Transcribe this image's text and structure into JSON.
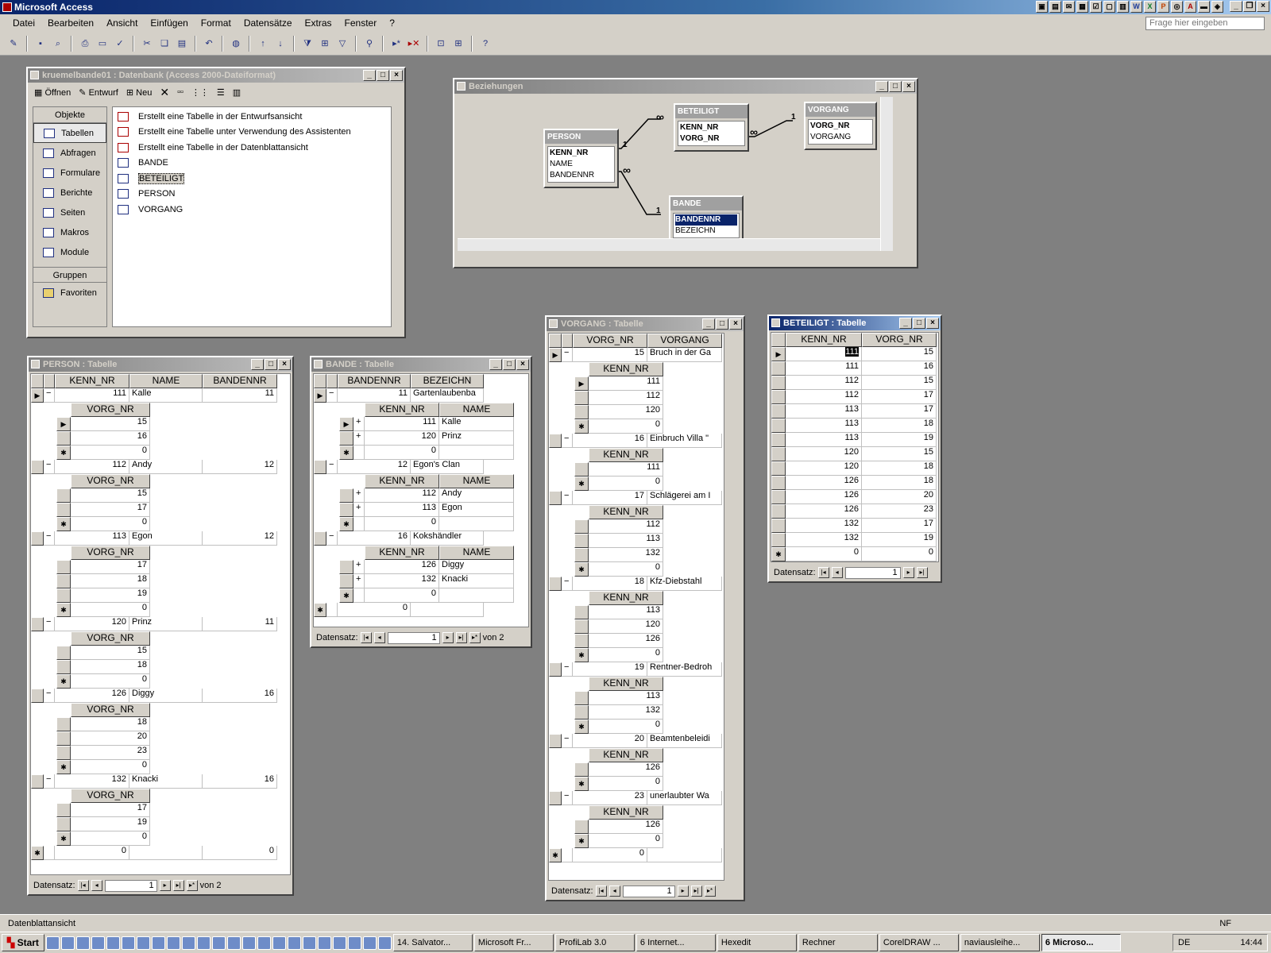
{
  "app_title": "Microsoft Access",
  "menu": [
    "Datei",
    "Bearbeiten",
    "Ansicht",
    "Einfügen",
    "Format",
    "Datensätze",
    "Extras",
    "Fenster",
    "?"
  ],
  "help_placeholder": "Frage hier eingeben",
  "db_window": {
    "title": "kruemelbande01 : Datenbank (Access 2000-Dateiformat)",
    "toolbar": {
      "open": "Öffnen",
      "design": "Entwurf",
      "new": "Neu"
    },
    "objects_header": "Objekte",
    "objects": [
      "Tabellen",
      "Abfragen",
      "Formulare",
      "Berichte",
      "Seiten",
      "Makros",
      "Module"
    ],
    "groups_header": "Gruppen",
    "favorites": "Favoriten",
    "list": [
      "Erstellt eine Tabelle in der Entwurfsansicht",
      "Erstellt eine Tabelle unter Verwendung des Assistenten",
      "Erstellt eine Tabelle in der Datenblattansicht",
      "BANDE",
      "BETEILIGT",
      "PERSON",
      "VORGANG"
    ]
  },
  "relations_window": {
    "title": "Beziehungen",
    "person": {
      "name": "PERSON",
      "fields": [
        "KENN_NR",
        "NAME",
        "BANDENNR"
      ]
    },
    "beteiligt": {
      "name": "BETEILIGT",
      "fields": [
        "KENN_NR",
        "VORG_NR"
      ]
    },
    "vorgang": {
      "name": "VORGANG",
      "fields": [
        "VORG_NR",
        "VORGANG"
      ]
    },
    "bande": {
      "name": "BANDE",
      "fields": [
        "BANDENNR",
        "BEZEICHN"
      ]
    },
    "one": "1",
    "many": "∞"
  },
  "person_table": {
    "title": "PERSON : Tabelle",
    "headers": [
      "KENN_NR",
      "NAME",
      "BANDENNR"
    ],
    "sub_header": "VORG_NR",
    "groups": [
      {
        "kenn": "111",
        "name": "Kalle",
        "bande": "11",
        "vorg": [
          "15",
          "16"
        ]
      },
      {
        "kenn": "112",
        "name": "Andy",
        "bande": "12",
        "vorg": [
          "15",
          "17"
        ]
      },
      {
        "kenn": "113",
        "name": "Egon",
        "bande": "12",
        "vorg": [
          "17",
          "18",
          "19"
        ]
      },
      {
        "kenn": "120",
        "name": "Prinz",
        "bande": "11",
        "vorg": [
          "15",
          "18"
        ]
      },
      {
        "kenn": "126",
        "name": "Diggy",
        "bande": "16",
        "vorg": [
          "18",
          "20",
          "23"
        ]
      },
      {
        "kenn": "132",
        "name": "Knacki",
        "bande": "16",
        "vorg": [
          "17",
          "19"
        ]
      }
    ],
    "new_row": [
      "0",
      "",
      "0"
    ],
    "nav_label": "Datensatz:",
    "nav_value": "1",
    "nav_of": "von  2"
  },
  "bande_table": {
    "title": "BANDE : Tabelle",
    "headers": [
      "BANDENNR",
      "BEZEICHN"
    ],
    "sub_headers": [
      "KENN_NR",
      "NAME"
    ],
    "groups": [
      {
        "nr": "11",
        "bez": "Gartenlaubenba",
        "members": [
          [
            "111",
            "Kalle"
          ],
          [
            "120",
            "Prinz"
          ]
        ]
      },
      {
        "nr": "12",
        "bez": "Egon's Clan",
        "members": [
          [
            "112",
            "Andy"
          ],
          [
            "113",
            "Egon"
          ]
        ]
      },
      {
        "nr": "16",
        "bez": "Kokshändler",
        "members": [
          [
            "126",
            "Diggy"
          ],
          [
            "132",
            "Knacki"
          ]
        ]
      }
    ],
    "new_row": "0",
    "nav_label": "Datensatz:",
    "nav_value": "1",
    "nav_of": "von 2"
  },
  "vorgang_table": {
    "title": "VORGANG : Tabelle",
    "headers": [
      "VORG_NR",
      "VORGANG"
    ],
    "sub_header": "KENN_NR",
    "groups": [
      {
        "nr": "15",
        "text": "Bruch in der Ga",
        "kenn": [
          "111",
          "112",
          "120"
        ]
      },
      {
        "nr": "16",
        "text": "Einbruch Villa \"",
        "kenn": [
          "111"
        ]
      },
      {
        "nr": "17",
        "text": "Schlägerei am I",
        "kenn": [
          "112",
          "113",
          "132"
        ]
      },
      {
        "nr": "18",
        "text": "Kfz-Diebstahl",
        "kenn": [
          "113",
          "120",
          "126"
        ]
      },
      {
        "nr": "19",
        "text": "Rentner-Bedroh",
        "kenn": [
          "113",
          "132"
        ]
      },
      {
        "nr": "20",
        "text": "Beamtenbeleidi",
        "kenn": [
          "126"
        ]
      },
      {
        "nr": "23",
        "text": "unerlaubter Wa",
        "kenn": [
          "126"
        ]
      }
    ],
    "new_row": "0",
    "nav_label": "Datensatz:",
    "nav_value": "1"
  },
  "beteiligt_table": {
    "title": "BETEILIGT : Tabelle",
    "headers": [
      "KENN_NR",
      "VORG_NR"
    ],
    "rows": [
      [
        "111",
        "15"
      ],
      [
        "111",
        "16"
      ],
      [
        "112",
        "15"
      ],
      [
        "112",
        "17"
      ],
      [
        "113",
        "17"
      ],
      [
        "113",
        "18"
      ],
      [
        "113",
        "19"
      ],
      [
        "120",
        "15"
      ],
      [
        "120",
        "18"
      ],
      [
        "126",
        "18"
      ],
      [
        "126",
        "20"
      ],
      [
        "126",
        "23"
      ],
      [
        "132",
        "17"
      ],
      [
        "132",
        "19"
      ]
    ],
    "new_row": [
      "0",
      "0"
    ],
    "nav_label": "Datensatz:",
    "nav_value": "1"
  },
  "status": {
    "text": "Datenblattansicht",
    "nf": "NF"
  },
  "taskbar": {
    "start": "Start",
    "tasks": [
      "14. Salvator...",
      "Microsoft Fr...",
      "ProfiLab 3.0",
      "6 Internet...",
      "Hexedit",
      "Rechner",
      "CorelDRAW ...",
      "naviausleihe...",
      "6 Microso..."
    ],
    "lang": "DE",
    "clock": "14:44"
  }
}
